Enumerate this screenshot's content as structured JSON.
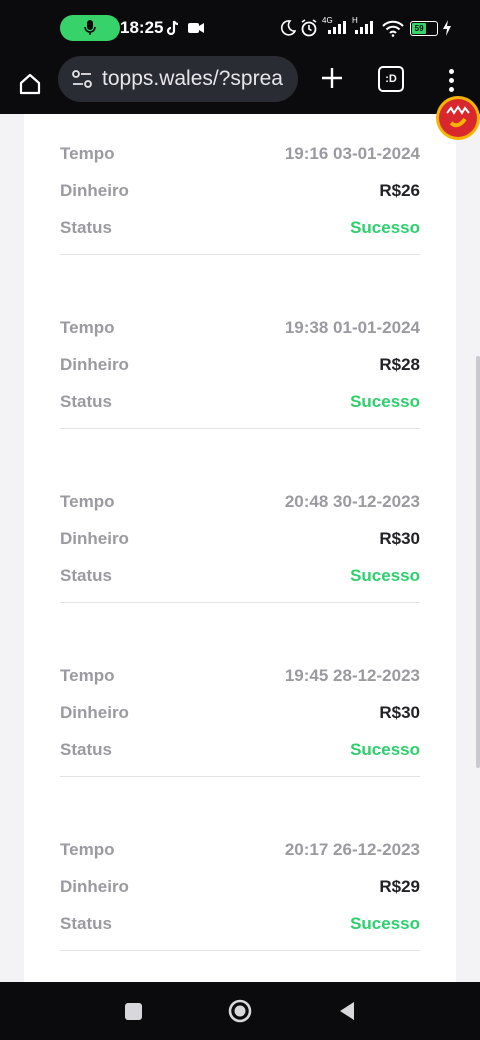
{
  "status_bar": {
    "time": "18:25",
    "battery": "59",
    "network_4g": "4G",
    "network_h": "H"
  },
  "browser": {
    "url": "topps.wales/?sprea",
    "tabs_label": ":D"
  },
  "labels": {
    "tempo": "Tempo",
    "dinheiro": "Dinheiro",
    "status": "Status"
  },
  "records": [
    {
      "tempo": "19:16 03-01-2024",
      "dinheiro": "R$26",
      "status": "Sucesso"
    },
    {
      "tempo": "19:38 01-01-2024",
      "dinheiro": "R$28",
      "status": "Sucesso"
    },
    {
      "tempo": "20:48 30-12-2023",
      "dinheiro": "R$30",
      "status": "Sucesso"
    },
    {
      "tempo": "19:45 28-12-2023",
      "dinheiro": "R$30",
      "status": "Sucesso"
    },
    {
      "tempo": "20:17 26-12-2023",
      "dinheiro": "R$29",
      "status": "Sucesso"
    }
  ],
  "colors": {
    "success": "#2ecf6e",
    "label_gray": "#9a9aa0",
    "money": "#222226"
  },
  "icons": [
    "mic-icon",
    "tiktok-icon",
    "video-icon",
    "moon-icon",
    "alarm-icon",
    "signal-icon",
    "wifi-icon",
    "battery-icon",
    "charging-icon",
    "home-icon",
    "site-settings-icon",
    "plus-icon",
    "tabs-icon",
    "more-icon",
    "avatar-icon",
    "recents-icon",
    "home-nav-icon",
    "back-icon"
  ]
}
